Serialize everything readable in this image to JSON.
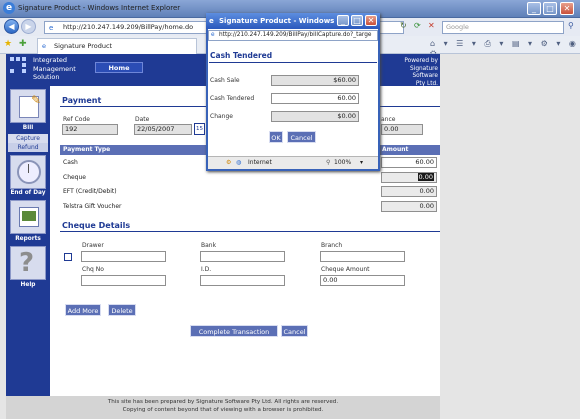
{
  "browser": {
    "title": "Signature Product - Windows Internet Explorer",
    "address": "http://210.247.149.209/BillPay/home.do",
    "search_placeholder": "Google",
    "tab_label": "Signature Product"
  },
  "app": {
    "brand_lines": [
      "Integrated",
      "Management",
      "Solution"
    ],
    "home": "Home",
    "powered": [
      "Powered by",
      "Signature Software",
      "Pty Ltd."
    ],
    "sidebar": [
      {
        "label": "Bill",
        "icon": "bill-pencil-icon"
      },
      {
        "label": "Capture",
        "icon": ""
      },
      {
        "label": "Refund",
        "icon": ""
      },
      {
        "label": "End of Day",
        "icon": "clock-icon"
      },
      {
        "label": "Reports",
        "icon": "reports-icon"
      },
      {
        "label": "Help",
        "icon": "question-mark-icon"
      }
    ]
  },
  "payment": {
    "heading": "Payment",
    "ref_code_label": "Ref Code",
    "ref_code": "192",
    "date_label": "Date",
    "date": "22/05/2007",
    "calendar": "15",
    "balance_label": "ance",
    "balance": "0.00",
    "table_head_type": "Payment Type",
    "table_head_amount": "Amount",
    "rows": [
      {
        "type": "Cash",
        "amount": "60.00"
      },
      {
        "type": "Cheque",
        "amount": "0.00"
      },
      {
        "type": "EFT (Credit/Debit)",
        "amount": "0.00"
      },
      {
        "type": "Telstra Gift Voucher",
        "amount": "0.00"
      }
    ]
  },
  "cheque": {
    "heading": "Cheque Details",
    "drawer": "Drawer",
    "bank": "Bank",
    "branch": "Branch",
    "chq_no": "Chq No",
    "id": "I.D.",
    "amount_label": "Cheque Amount",
    "amount": "0.00"
  },
  "buttons": {
    "add_more": "Add More",
    "delete": "Delete",
    "complete": "Complete Transaction",
    "cancel": "Cancel"
  },
  "footer": [
    "This site has been prepared by Signature Software Pty Ltd. All rights are reserved.",
    "Copying of content beyond that of viewing with a browser is prohibited."
  ],
  "popup": {
    "title": "Signature Product - Windows I...",
    "address": "http://210.247.149.209/BillPay/billCapture.do?_targe",
    "heading": "Cash Tendered",
    "cash_sale_label": "Cash Sale",
    "cash_sale": "$60.00",
    "tendered_label": "Cash Tendered",
    "tendered": "60.00",
    "change_label": "Change",
    "change": "$0.00",
    "ok": "OK",
    "cancel": "Cancel",
    "zone": "Internet",
    "zoom": "100%"
  }
}
